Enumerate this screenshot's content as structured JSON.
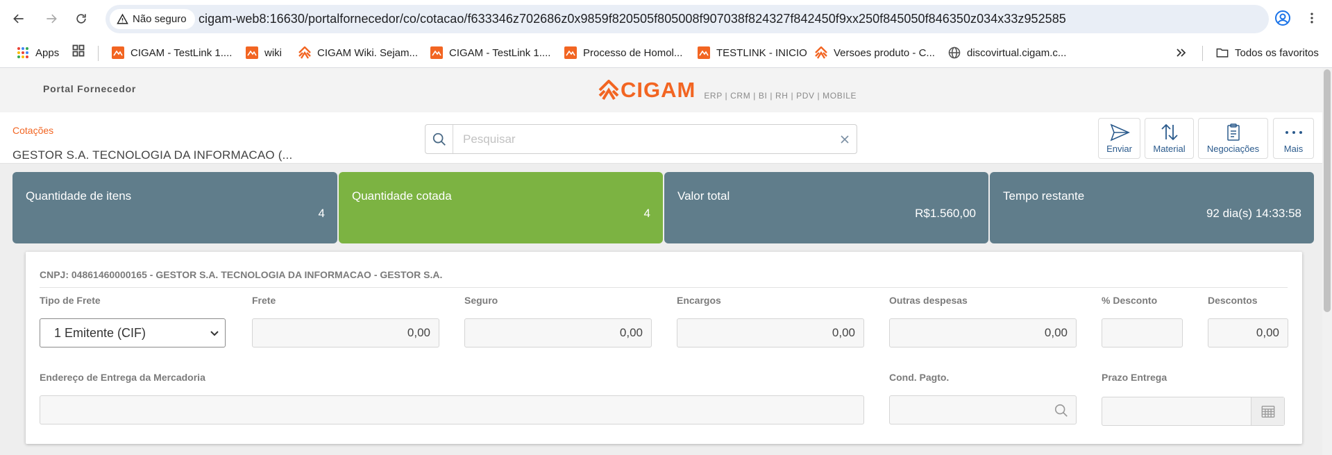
{
  "browser": {
    "security_label": "Não seguro",
    "url": "cigam-web8:16630/portalfornecedor/co/cotacao/f633346z702686z0x9859f820505f805008f907038f824327f842450f9xx250f845050f846350z034x33z952585",
    "bookmarks": [
      {
        "label": "Apps",
        "icon": "apps-grid-icon"
      },
      {
        "label": "CIGAM - TestLink 1....",
        "icon": "testlink-icon"
      },
      {
        "label": "wiki",
        "icon": "testlink-icon"
      },
      {
        "label": "CIGAM Wiki. Sejam...",
        "icon": "cigam-icon"
      },
      {
        "label": "CIGAM - TestLink 1....",
        "icon": "testlink-icon"
      },
      {
        "label": "Processo de Homol...",
        "icon": "testlink-icon"
      },
      {
        "label": "TESTLINK - INICIO",
        "icon": "testlink-icon"
      },
      {
        "label": "Versoes produto - C...",
        "icon": "cigam-icon"
      },
      {
        "label": "discovirtual.cigam.c...",
        "icon": "globe-icon"
      }
    ],
    "all_bookmarks_label": "Todos os favoritos"
  },
  "header": {
    "portal_title": "Portal Fornecedor",
    "logo_text": "CIGAM",
    "logo_subtitle": "ERP | CRM | BI | RH | PDV | MOBILE"
  },
  "toolbar": {
    "breadcrumb": "Cotações",
    "supplier_name": "GESTOR S.A. TECNOLOGIA DA INFORMACAO (...",
    "search_placeholder": "Pesquisar",
    "search_value": "",
    "actions": [
      {
        "label": "Enviar",
        "icon": "send-icon"
      },
      {
        "label": "Material",
        "icon": "sort-arrows-icon"
      },
      {
        "label": "Negociações",
        "icon": "document-icon"
      },
      {
        "label": "Mais",
        "icon": "more-dots-icon"
      }
    ]
  },
  "summary": [
    {
      "title": "Quantidade de itens",
      "value": "4",
      "color": "#607d8b"
    },
    {
      "title": "Quantidade cotada",
      "value": "4",
      "color": "#7cb342"
    },
    {
      "title": "Valor total",
      "value": "R$1.560,00",
      "color": "#607d8b"
    },
    {
      "title": "Tempo restante",
      "value": "92 dia(s) 14:33:58",
      "color": "#607d8b"
    }
  ],
  "form": {
    "cnpj_header": "CNPJ: 04861460000165 - GESTOR S.A. TECNOLOGIA DA INFORMACAO - GESTOR S.A.",
    "tipo_frete": {
      "label": "Tipo de Frete",
      "value": "1 Emitente (CIF)"
    },
    "frete": {
      "label": "Frete",
      "value": "0,00"
    },
    "seguro": {
      "label": "Seguro",
      "value": "0,00"
    },
    "encargos": {
      "label": "Encargos",
      "value": "0,00"
    },
    "outras_despesas": {
      "label": "Outras despesas",
      "value": "0,00"
    },
    "pct_desconto": {
      "label": "% Desconto",
      "value": ""
    },
    "descontos": {
      "label": "Descontos",
      "value": "0,00"
    },
    "endereco": {
      "label": "Endereço de Entrega da Mercadoria",
      "value": ""
    },
    "cond_pagto": {
      "label": "Cond. Pagto.",
      "value": ""
    },
    "prazo_entrega": {
      "label": "Prazo Entrega",
      "value": ""
    }
  },
  "colors": {
    "brand_orange": "#f26522",
    "card_slate": "#607d8b",
    "card_green": "#7cb342",
    "action_blue": "#2a5a8c"
  }
}
